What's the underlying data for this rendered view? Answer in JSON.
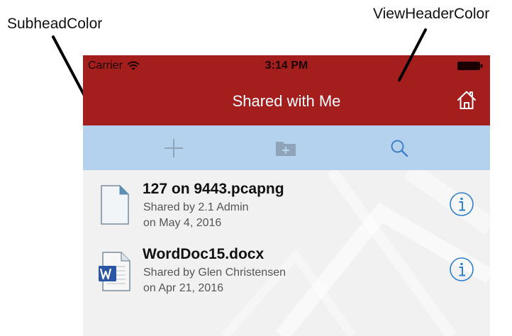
{
  "annotations": {
    "subhead_label": "SubheadColor",
    "header_label": "ViewHeaderColor"
  },
  "status_bar": {
    "carrier": "Carrier",
    "time": "3:14 PM"
  },
  "header": {
    "title": "Shared with Me",
    "home_icon": "home-icon"
  },
  "toolbar": {
    "items": [
      {
        "icon": "plus-icon"
      },
      {
        "icon": "folder-add-icon"
      },
      {
        "icon": "search-icon"
      }
    ]
  },
  "files": [
    {
      "name": "127 on 9443.pcapng",
      "shared_by": "Shared by 2.1 Admin",
      "date": "on May 4, 2016",
      "icon": "document-icon"
    },
    {
      "name": "WordDoc15.docx",
      "shared_by": "Shared by Glen Christensen",
      "date": "on Apr 21, 2016",
      "icon": "word-document-icon"
    }
  ],
  "colors": {
    "view_header": "#a51e1e",
    "subhead": "#b4d2ee",
    "list_background": "#f1f1f1",
    "accent": "#2f7fd0"
  }
}
